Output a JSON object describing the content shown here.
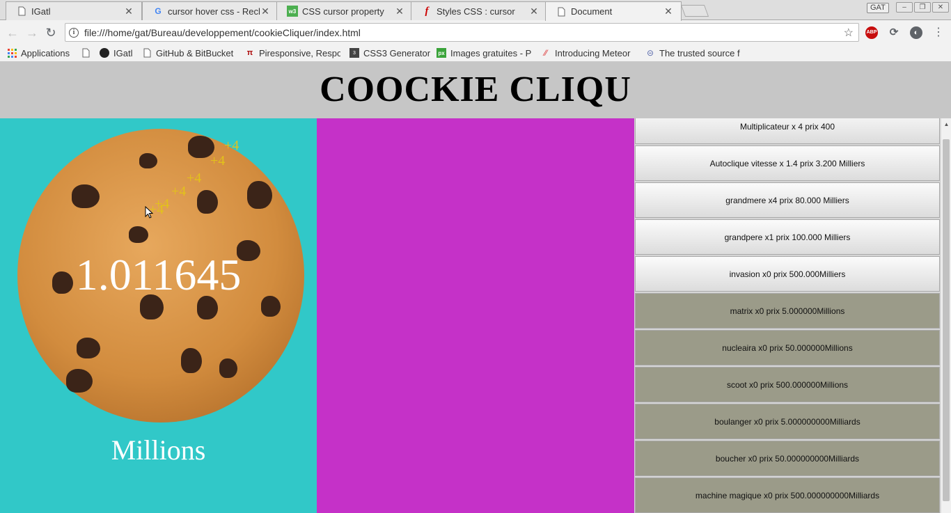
{
  "browser": {
    "tabs": [
      {
        "title": "IGatl",
        "favicon": "page-icon",
        "active": false
      },
      {
        "title": "cursor hover css - Rech",
        "favicon": "google-icon",
        "active": false
      },
      {
        "title": "CSS cursor property",
        "favicon": "w3schools-icon",
        "active": false
      },
      {
        "title": "Styles CSS : cursor",
        "favicon": "f-icon",
        "active": false
      },
      {
        "title": "Document",
        "favicon": "page-icon",
        "active": true
      }
    ],
    "profile": "GAT",
    "url": "file:///home/gat/Bureau/developpement/cookieCliquer/index.html",
    "bookmarks": [
      {
        "label": "Applications",
        "icon": "apps-grid-icon"
      },
      {
        "label": "",
        "icon": "page-icon"
      },
      {
        "label": "IGatl",
        "icon": "github-icon"
      },
      {
        "label": "GitHub & BitBucket I",
        "icon": "page-icon"
      },
      {
        "label": "Piresponsive, Respo",
        "icon": "pi-icon"
      },
      {
        "label": "CSS3 Generator",
        "icon": "css3-icon"
      },
      {
        "label": "Images gratuites - Pi",
        "icon": "px-icon"
      },
      {
        "label": "Introducing Meteor",
        "icon": "meteor-icon"
      },
      {
        "label": "The trusted source f",
        "icon": "planet-icon"
      }
    ],
    "extensions": [
      {
        "name": "adblock-icon",
        "label": "ABP",
        "color": "#c70d0d"
      },
      {
        "name": "sync-icon",
        "label": "",
        "color": "#5f6368"
      },
      {
        "name": "moon-icon",
        "label": "",
        "color": "#5f6368"
      }
    ]
  },
  "page": {
    "title": "COOCKIE CLIQU",
    "counter": "1.011645",
    "unit": "Millions",
    "click_gains": [
      "+4",
      "+4",
      "+4",
      "+4",
      "+4",
      "+4"
    ],
    "colors": {
      "header": "#c6c6c6",
      "left": "#31c8c8",
      "middle": "#c531c8",
      "disabled_item": "#9b9b89"
    },
    "shop": [
      {
        "label": "Multiplicateur x 4 prix 400",
        "enabled": true
      },
      {
        "label": "Autoclique vitesse x 1.4 prix 3.200 Milliers",
        "enabled": true
      },
      {
        "label": "grandmere x4 prix 80.000 Milliers",
        "enabled": true
      },
      {
        "label": "grandpere x1 prix 100.000 Milliers",
        "enabled": true
      },
      {
        "label": "invasion x0 prix 500.000Milliers",
        "enabled": true
      },
      {
        "label": "matrix x0 prix 5.000000Millions",
        "enabled": false
      },
      {
        "label": "nucleaira x0 prix 50.000000Millions",
        "enabled": false
      },
      {
        "label": "scoot x0 prix 500.000000Millions",
        "enabled": false
      },
      {
        "label": "boulanger x0 prix 5.000000000Milliards",
        "enabled": false
      },
      {
        "label": "boucher x0 prix 50.000000000Milliards",
        "enabled": false
      },
      {
        "label": "machine magique x0 prix 500.000000000Milliards",
        "enabled": false
      }
    ]
  }
}
